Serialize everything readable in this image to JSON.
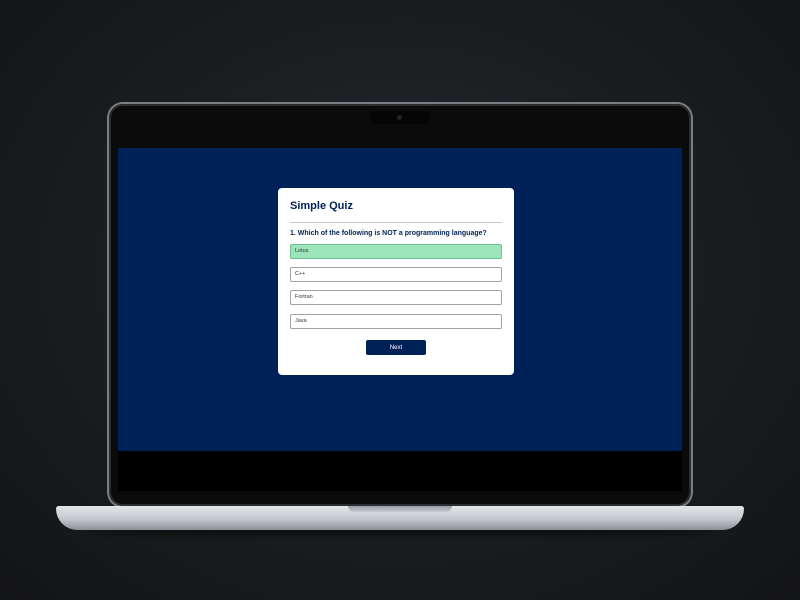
{
  "quiz": {
    "title": "Simple Quiz",
    "question": "1. Which of the following is NOT a programming language?",
    "options": [
      {
        "label": "Lotus",
        "state": "correct"
      },
      {
        "label": "C++",
        "state": "default"
      },
      {
        "label": "Fortran",
        "state": "default"
      },
      {
        "label": "Java",
        "state": "default"
      }
    ],
    "next_label": "Next"
  },
  "colors": {
    "screen_background": "#002157",
    "card_background": "#ffffff",
    "accent": "#002157",
    "correct_highlight": "#9ce4b9"
  }
}
